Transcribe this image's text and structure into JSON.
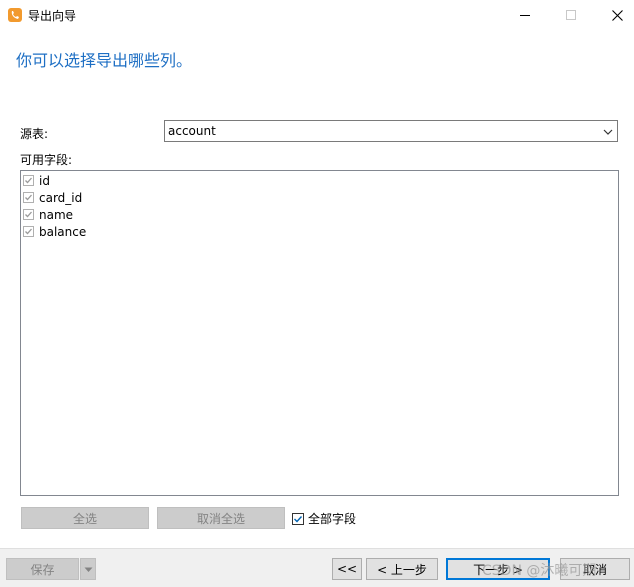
{
  "window": {
    "title": "导出向导",
    "icon": "navicat-app-icon",
    "minimize_icon": "minimize-icon",
    "maximize_icon": "maximize-icon",
    "close_icon": "close-icon"
  },
  "heading": "你可以选择导出哪些列。",
  "source": {
    "label": "源表:",
    "value": "account"
  },
  "fields": {
    "label": "可用字段:",
    "items": [
      {
        "name": "id",
        "checked": true
      },
      {
        "name": "card_id",
        "checked": true
      },
      {
        "name": "name",
        "checked": true
      },
      {
        "name": "balance",
        "checked": true
      }
    ]
  },
  "buttons": {
    "select_all": "全选",
    "deselect_all": "取消全选",
    "all_fields_label": "全部字段",
    "all_fields_checked": true
  },
  "footer": {
    "save": "保存",
    "first": "<<",
    "prev": "< 上一步",
    "next": "下一步 >",
    "cancel": "取消"
  },
  "watermark": "CSDN @沐曦可期",
  "colors": {
    "heading": "#1e6fc4",
    "accent": "#0078d7",
    "disabled_bg": "#cccccc"
  }
}
